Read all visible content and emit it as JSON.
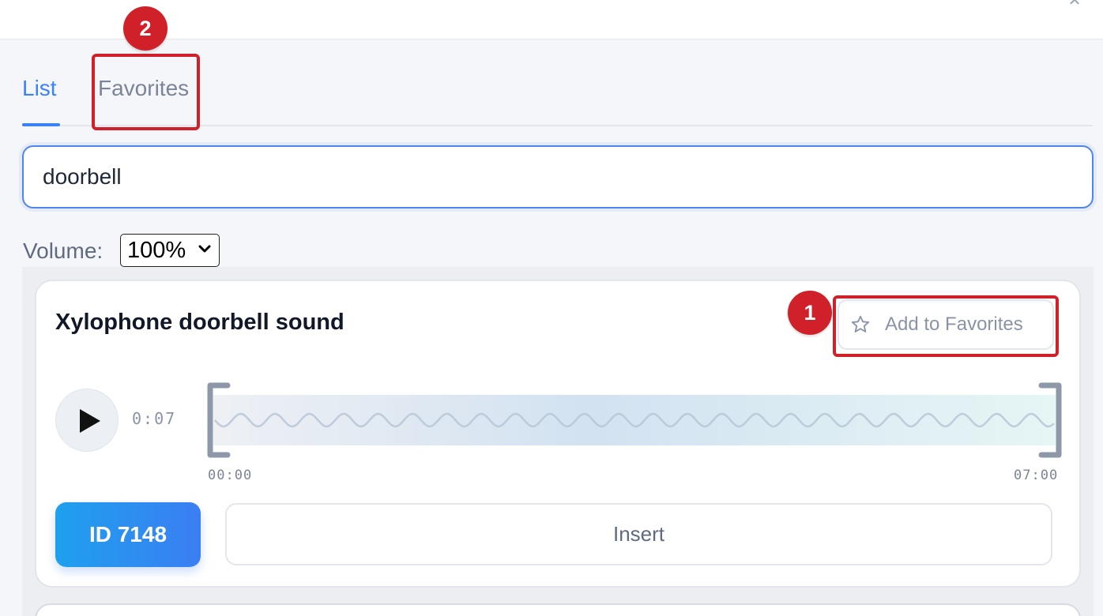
{
  "header": {
    "close_glyph": "✕"
  },
  "tabs": [
    {
      "label": "List",
      "active": true
    },
    {
      "label": "Favorites",
      "active": false
    }
  ],
  "search": {
    "value": "doorbell"
  },
  "volume": {
    "label": "Volume:",
    "selected": "100%"
  },
  "sound_card": {
    "title": "Xylophone doorbell sound",
    "favorite_label": "Add to Favorites",
    "favorite_icon": "star-outline-icon",
    "play_icon": "play-icon",
    "duration": "0:07",
    "time_start": "00:00",
    "time_end": "07:00",
    "id_label": "ID 7148",
    "insert_label": "Insert"
  },
  "annotations": [
    {
      "number": "1",
      "target": "Add to Favorites"
    },
    {
      "number": "2",
      "target": "Favorites"
    }
  ],
  "colors": {
    "accent": "#3b82f6",
    "highlight": "#d0202a",
    "id_gradient_start": "#1ea0ee",
    "id_gradient_end": "#3b7ef3"
  }
}
